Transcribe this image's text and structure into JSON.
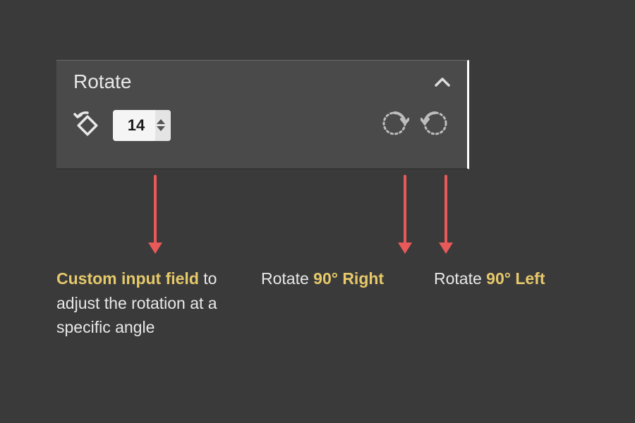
{
  "panel": {
    "title": "Rotate",
    "angle_value": "14"
  },
  "annotations": {
    "custom_input": {
      "highlight": "Custom input field",
      "rest": " to adjust the rotation at a specific angle"
    },
    "rotate_right": {
      "prefix": "Rotate ",
      "highlight": "90° Right"
    },
    "rotate_left": {
      "prefix": "Rotate ",
      "highlight": "90° Left"
    }
  }
}
